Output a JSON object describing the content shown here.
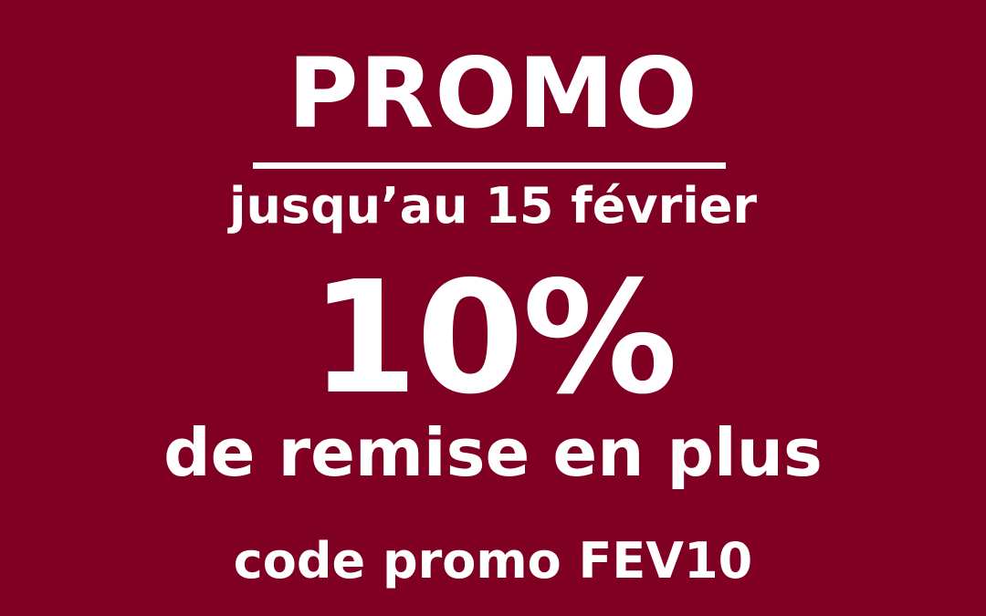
{
  "promo": {
    "title": "PROMO",
    "date": "jusqu’au 15 février",
    "discount_value": "10%",
    "discount_text": "de remise en plus",
    "code": "code promo FEV10"
  },
  "colors": {
    "background": "#800024",
    "text": "#ffffff"
  }
}
